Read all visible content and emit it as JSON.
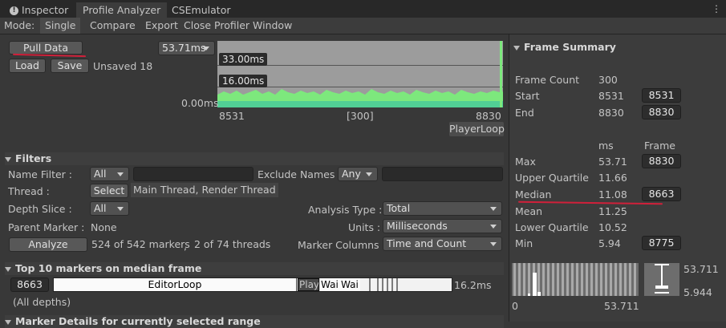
{
  "tabs": {
    "inspector": "Inspector",
    "profile_analyzer": "Profile Analyzer",
    "cs_emulator": "CSEmulator",
    "menu": "⋮"
  },
  "mode": {
    "label": "Mode:",
    "single": "Single",
    "compare": "Compare",
    "export": "Export",
    "close": "Close Profiler Window"
  },
  "toolbar": {
    "pull_data": "Pull Data",
    "load": "Load",
    "save": "Save",
    "status": "Unsaved 18",
    "range": "53.71ms"
  },
  "graph": {
    "line_high": "33.00ms",
    "line_low": "16.00ms",
    "zero": "0.00ms",
    "start": "8531",
    "count": "[300]",
    "end": "8830",
    "marker": "PlayerLoop"
  },
  "filters": {
    "title": "Filters",
    "name_filter_label": "Name Filter :",
    "name_filter_mode": "All",
    "exclude_label": "Exclude Names :",
    "exclude_mode": "Any",
    "thread_label": "Thread :",
    "select_btn": "Select",
    "threads": "Main Thread, Render Thread",
    "depth_label": "Depth Slice :",
    "depth_value": "All",
    "analysis_label": "Analysis Type :",
    "analysis_value": "Total",
    "parent_label": "Parent Marker :",
    "parent_value": "None",
    "units_label": "Units :",
    "units_value": "Milliseconds",
    "analyze_btn": "Analyze",
    "markers_count": "524 of 542 markers",
    "comma": ",",
    "threads_count": "2 of 74 threads",
    "columns_label": "Marker Columns :",
    "columns_value": "Time and Count"
  },
  "top_markers": {
    "title": "Top 10 markers on median frame",
    "frame": "8663",
    "bar_main": "EditorLoop",
    "bar_play": "Play",
    "bar_wait1": "Wai",
    "bar_wait2": "Wai",
    "total": "16.2ms",
    "depths": "(All depths)",
    "next_title": "Marker Details for currently selected range"
  },
  "summary": {
    "title": "Frame Summary",
    "frame_count_label": "Frame Count",
    "frame_count": "300",
    "start_label": "Start",
    "start_value": "8531",
    "start_btn": "8531",
    "end_label": "End",
    "end_value": "8830",
    "end_btn": "8830",
    "col_ms": "ms",
    "col_frame": "Frame",
    "max_label": "Max",
    "max_ms": "53.71",
    "max_frame": "8830",
    "uq_label": "Upper Quartile",
    "uq_ms": "11.66",
    "median_label": "Median",
    "median_ms": "11.08",
    "median_frame": "8663",
    "mean_label": "Mean",
    "mean_ms": "11.25",
    "lq_label": "Lower Quartile",
    "lq_ms": "10.52",
    "min_label": "Min",
    "min_ms": "5.94",
    "min_frame": "8775",
    "hist_min": "0",
    "hist_max": "53.711",
    "box_max": "53.711",
    "box_min": "5.944"
  },
  "colors": {
    "accent_red": "#d0203a",
    "graph_green": "#7de87d",
    "background": "#383838"
  }
}
